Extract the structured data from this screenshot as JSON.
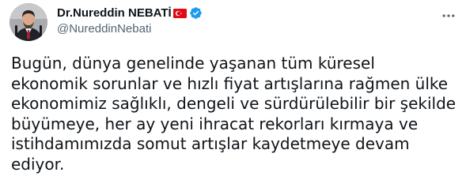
{
  "author": {
    "display_name": "Dr.Nureddin NEBATİ",
    "handle": "@NureddinNebati",
    "flag_icon": "turkey-flag-icon",
    "verified_icon": "verified-badge-icon",
    "verified_color": "#1d9bf0"
  },
  "tweet": {
    "text_lines": [
      "Bugün, dünya genelinde yaşanan tüm küresel",
      "ekonomik sorunlar ve hızlı fiyat artışlarına rağmen ülke",
      "ekonomimiz sağlıklı, dengeli ve sürdürülebilir bir şekilde",
      "büyümeye, her ay yeni ihracat rekorları kırmaya ve",
      "istihdamımızda somut artışlar kaydetmeye devam",
      "ediyor."
    ]
  },
  "actions": {
    "more_icon": "more-horizontal-icon"
  },
  "colors": {
    "text_primary": "#0f1419",
    "text_secondary": "#536471",
    "flag_red": "#e30a17"
  }
}
